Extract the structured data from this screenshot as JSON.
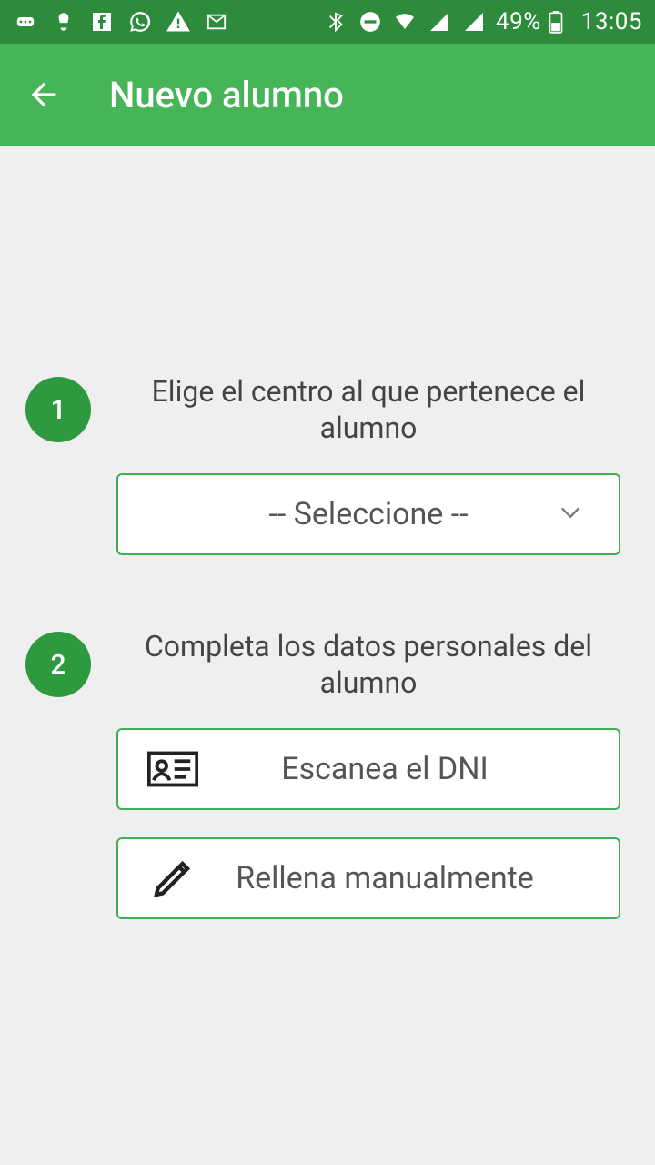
{
  "status": {
    "battery_text": "49%",
    "clock": "13:05"
  },
  "appbar": {
    "title": "Nuevo alumno"
  },
  "steps": {
    "one": {
      "num": "1",
      "text": "Elige el centro al que pertenece el alumno"
    },
    "two": {
      "num": "2",
      "text": "Completa los datos personales del alumno"
    }
  },
  "select": {
    "placeholder": "-- Seleccione --"
  },
  "options": {
    "scan": "Escanea el DNI",
    "manual": "Rellena manualmente"
  }
}
